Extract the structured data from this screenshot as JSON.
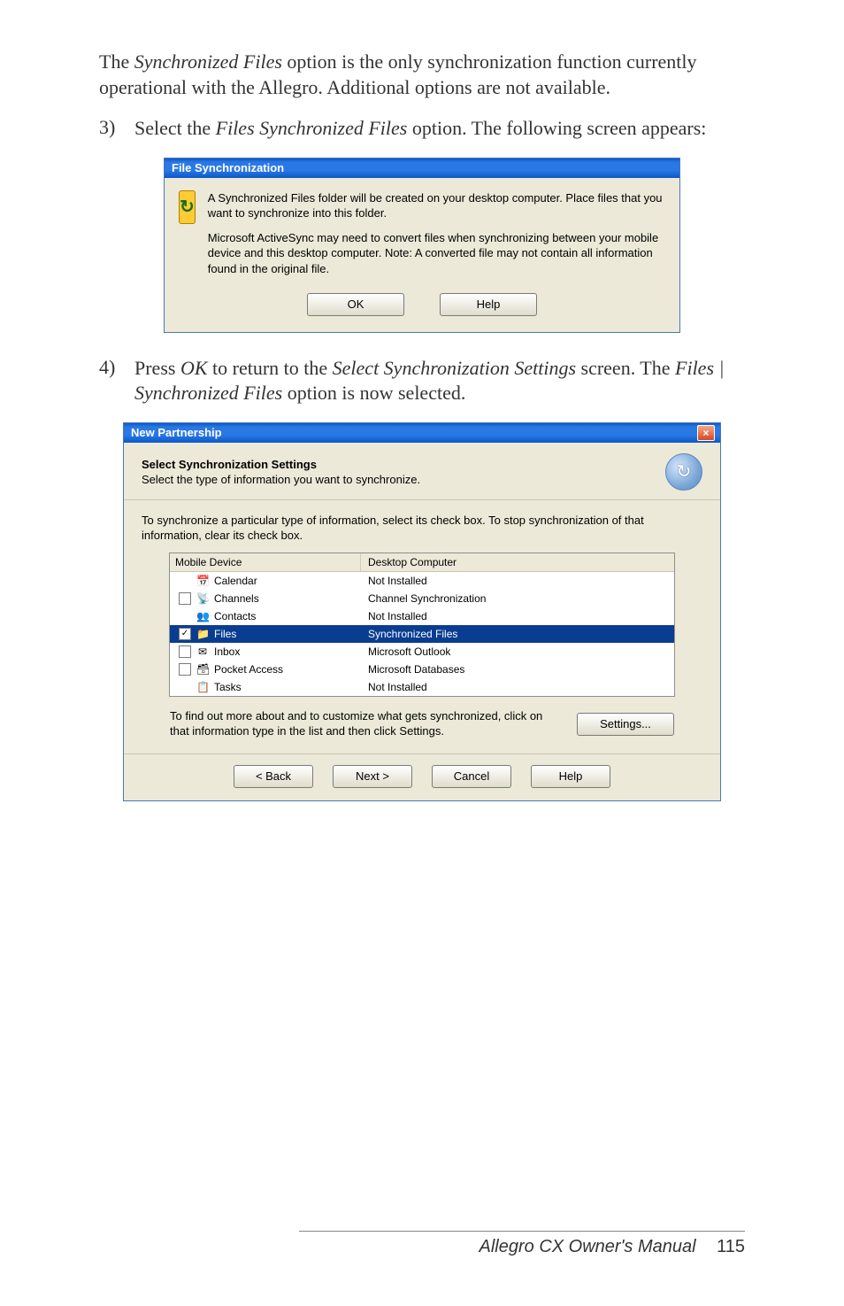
{
  "intro_text": "The Synchronized Files option is the only synchronization function currently operational with the Allegro. Additional options are not available.",
  "step3": {
    "num": "3)",
    "pre": "Select the ",
    "italic": "Files Synchronized Files",
    "post": " option. The following screen appears:"
  },
  "dialog1": {
    "title": "File Synchronization",
    "para1": "A Synchronized Files folder will be created on your desktop computer. Place files that you want to synchronize into this folder.",
    "para2": "Microsoft ActiveSync may need to convert files when synchronizing between your mobile device and this desktop computer.  Note: A converted file may not contain all information found in the original file.",
    "ok": "OK",
    "help": "Help",
    "icon_glyph": "↻"
  },
  "step4": {
    "num": "4)",
    "pre": "Press ",
    "ok_italic": "OK",
    "mid": " to return to the ",
    "screen_italic": "Select Synchronization Settings",
    "mid2": " screen. The ",
    "files_italic": "Files | Synchronized Files",
    "post": " option is now selected."
  },
  "dialog2": {
    "title": "New Partnership",
    "close": "×",
    "heading": "Select Synchronization Settings",
    "subheading": "Select the type of information you want to synchronize.",
    "icon_glyph": "↻",
    "note": "To synchronize a particular type of information, select its check box. To stop synchronization of that information, clear its check box.",
    "col1": "Mobile Device",
    "col2": "Desktop Computer",
    "rows": [
      {
        "check": "none",
        "icon": "📅",
        "name": "Calendar",
        "desktop": "Not Installed",
        "selected": false
      },
      {
        "check": "unchecked",
        "icon": "📡",
        "name": "Channels",
        "desktop": "Channel Synchronization",
        "selected": false
      },
      {
        "check": "none",
        "icon": "👥",
        "name": "Contacts",
        "desktop": "Not Installed",
        "selected": false
      },
      {
        "check": "checked",
        "icon": "📁",
        "name": "Files",
        "desktop": "Synchronized Files",
        "selected": true
      },
      {
        "check": "unchecked",
        "icon": "✉",
        "name": "Inbox",
        "desktop": "Microsoft Outlook",
        "selected": false
      },
      {
        "check": "unchecked",
        "icon": "🗃",
        "name": "Pocket Access",
        "desktop": "Microsoft Databases",
        "selected": false
      },
      {
        "check": "none",
        "icon": "📋",
        "name": "Tasks",
        "desktop": "Not Installed",
        "selected": false
      }
    ],
    "find_out": "To find out more about and to customize what gets synchronized, click on that information type in the list and then click Settings.",
    "settings_btn": "Settings...",
    "back": "< Back",
    "next": "Next >",
    "cancel": "Cancel",
    "help": "Help"
  },
  "footer": {
    "title": "Allegro CX Owner's Manual",
    "page": "115"
  }
}
